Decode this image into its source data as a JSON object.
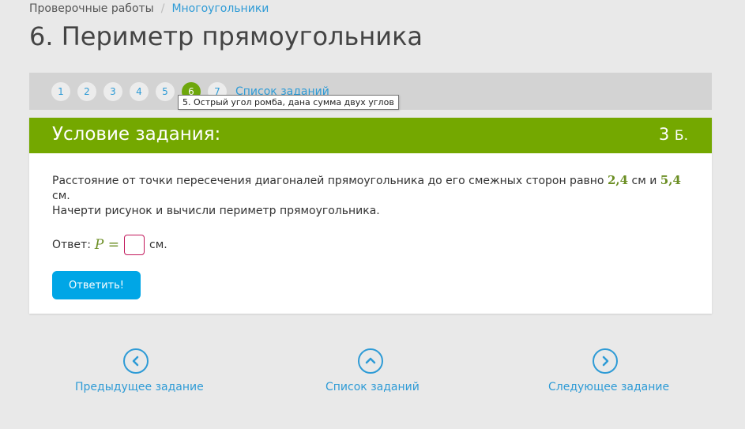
{
  "breadcrumb": {
    "parent": "Проверочные работы",
    "separator": "/",
    "current": "Многоугольники"
  },
  "page_title": "6. Периметр прямоугольника",
  "pager": {
    "pages": [
      "1",
      "2",
      "3",
      "4",
      "5",
      "6",
      "7"
    ],
    "active": "6",
    "task_list_label": "Список заданий"
  },
  "tooltip": "5. Острый угол ромба, дана сумма двух углов",
  "task": {
    "header": "Условие задания:",
    "points_value": "3",
    "points_unit": "Б.",
    "statement_part1": "Расстояние от точки пересечения диагоналей прямоугольника до его смежных сторон равно",
    "value1": "2,4",
    "unit1": "см и",
    "value2": "5,4",
    "unit2": "см.",
    "statement_part2": "Начерти рисунок и вычисли периметр прямоугольника.",
    "answer_label": "Ответ:",
    "answer_var": "P",
    "answer_eq": "=",
    "answer_unit": "см.",
    "answer_value": "",
    "submit_label": "Ответить!"
  },
  "bottom_nav": {
    "prev_label": "Предыдущее задание",
    "list_label": "Список заданий",
    "next_label": "Следующее задание"
  },
  "colors": {
    "accent_green": "#74a800",
    "link_blue": "#2e9bd6",
    "button_blue": "#00a6e6",
    "input_border": "#c2185b"
  }
}
